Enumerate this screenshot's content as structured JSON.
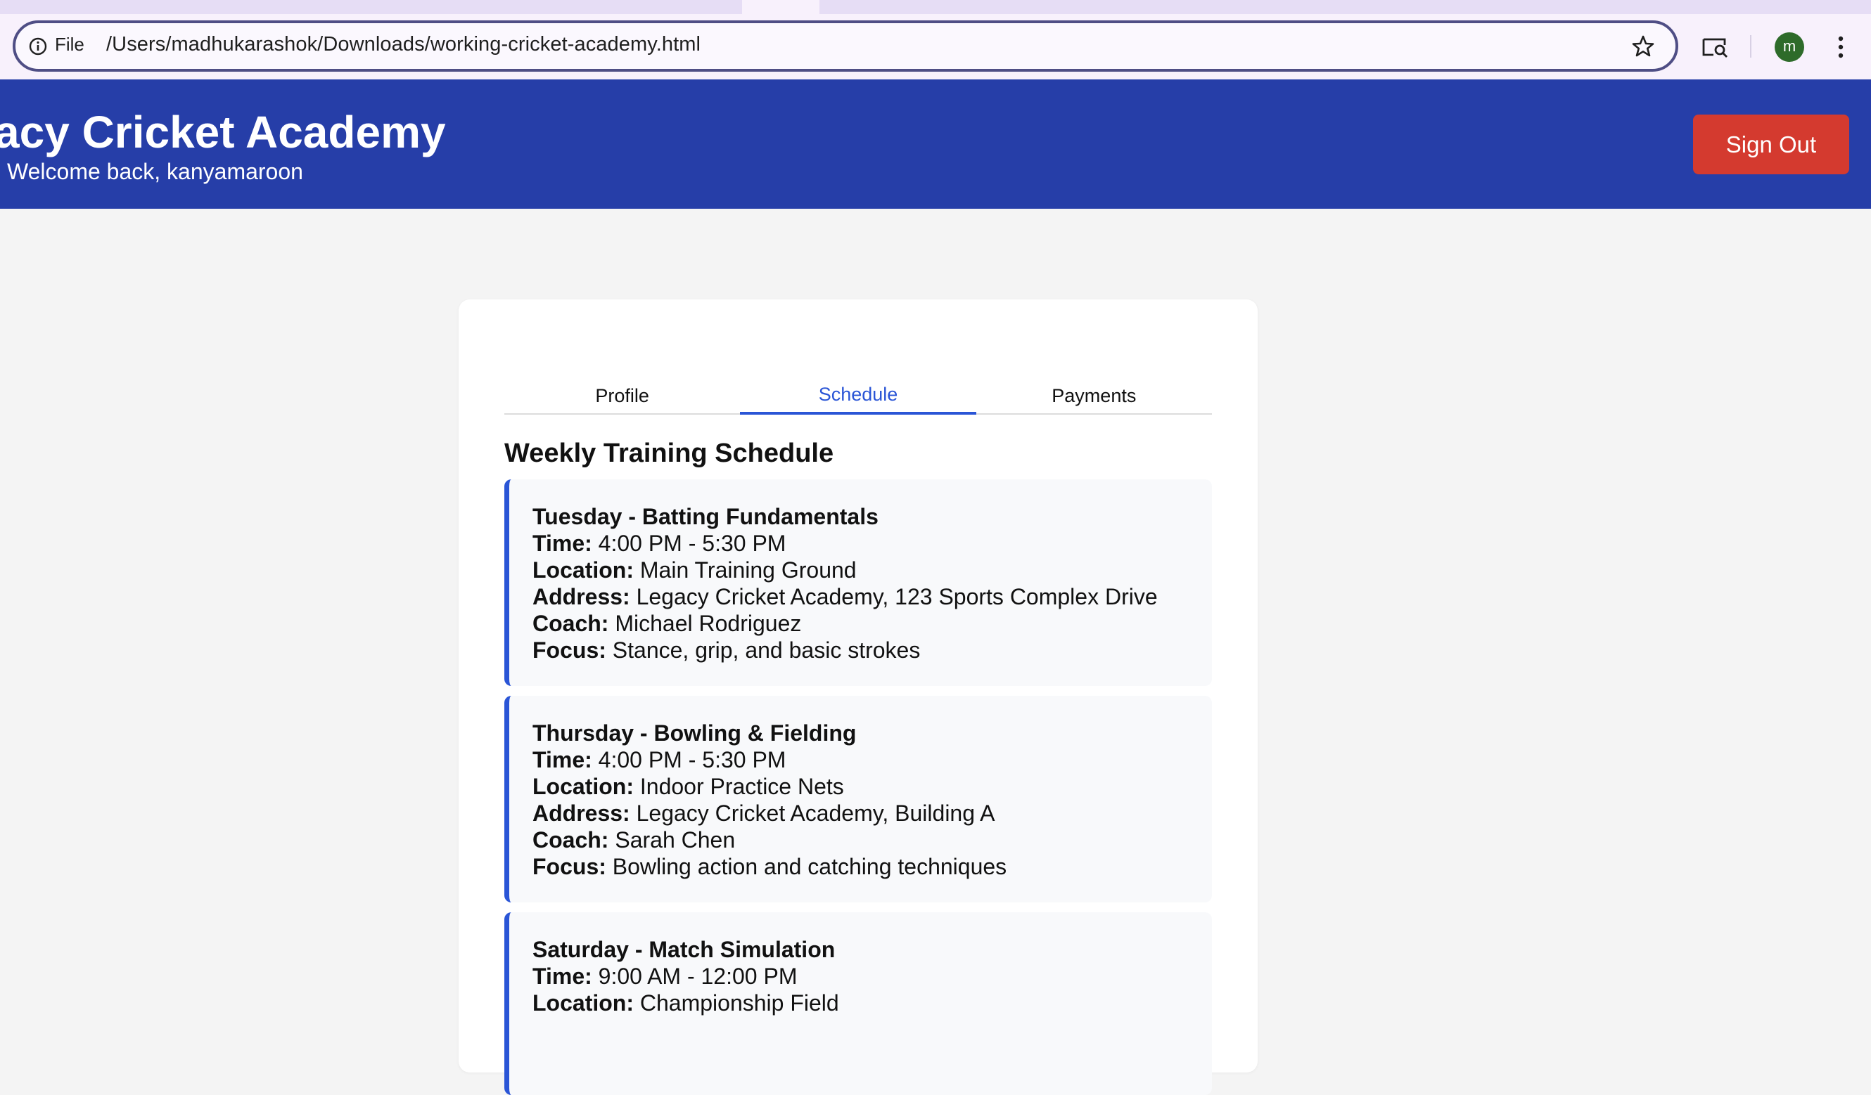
{
  "browser": {
    "file_label": "File",
    "url": "/Users/madhukarashok/Downloads/working-cricket-academy.html",
    "avatar_letter": "m",
    "avatar_color": "#2e6b2a"
  },
  "header": {
    "title": "acy Cricket Academy",
    "welcome": "Welcome back, kanyamaroon",
    "signout_label": "Sign Out",
    "bg_color": "#263ea8",
    "signout_color": "#d43a2f"
  },
  "tabs": [
    {
      "label": "Profile",
      "active": false
    },
    {
      "label": "Schedule",
      "active": true
    },
    {
      "label": "Payments",
      "active": false
    }
  ],
  "schedule": {
    "title": "Weekly Training Schedule",
    "labels": {
      "time": "Time:",
      "location": "Location:",
      "address": "Address:",
      "coach": "Coach:",
      "focus": "Focus:"
    },
    "sessions": [
      {
        "heading": "Tuesday - Batting Fundamentals",
        "time": "4:00 PM - 5:30 PM",
        "location": "Main Training Ground",
        "address": "Legacy Cricket Academy, 123 Sports Complex Drive",
        "coach": "Michael Rodriguez",
        "focus": "Stance, grip, and basic strokes"
      },
      {
        "heading": "Thursday - Bowling & Fielding",
        "time": "4:00 PM - 5:30 PM",
        "location": "Indoor Practice Nets",
        "address": "Legacy Cricket Academy, Building A",
        "coach": "Sarah Chen",
        "focus": "Bowling action and catching techniques"
      },
      {
        "heading": "Saturday - Match Simulation",
        "time": "9:00 AM - 12:00 PM",
        "location": "Championship Field"
      }
    ]
  },
  "accent_color": "#2a55d6"
}
